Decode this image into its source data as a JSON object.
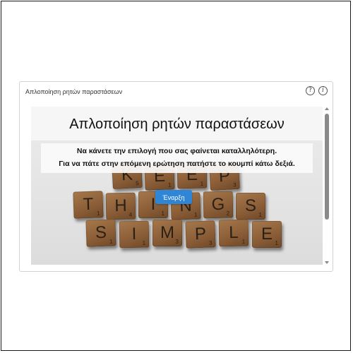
{
  "widget": {
    "header_title": "Απλοποίηση ρητών παραστάσεων",
    "help_icon": "question-circle-icon",
    "info_icon": "info-circle-icon",
    "help_symbol": "?",
    "info_symbol": "i"
  },
  "slide": {
    "title": "Απλοποίηση ρητών παραστάσεων",
    "instruction_line1": "Να κάνετε την επιλογή που σας φαίνεται καταλληλότερη.",
    "instruction_line2": "Για να πάτε στην επόμενη ερώτηση πατήστε το κουμπί κάτω δεξιά.",
    "start_button_label": "Έναρξη"
  },
  "image_tiles": {
    "row1": [
      {
        "letter": "K",
        "value": "5"
      },
      {
        "letter": "E",
        "value": "1"
      },
      {
        "letter": "E",
        "value": "1"
      },
      {
        "letter": "P",
        "value": "3"
      }
    ],
    "row2": [
      {
        "letter": "T",
        "value": "1"
      },
      {
        "letter": "H",
        "value": "4"
      },
      {
        "letter": "I",
        "value": "1"
      },
      {
        "letter": "N",
        "value": "1"
      },
      {
        "letter": "G",
        "value": "2"
      },
      {
        "letter": "S",
        "value": "1"
      }
    ],
    "row3": [
      {
        "letter": "S",
        "value": "1"
      },
      {
        "letter": "I",
        "value": "1"
      },
      {
        "letter": "M",
        "value": "3"
      },
      {
        "letter": "P",
        "value": "3"
      },
      {
        "letter": "L",
        "value": "1"
      },
      {
        "letter": "E",
        "value": "1"
      }
    ]
  },
  "colors": {
    "start_button": "#2f86d6",
    "tile_wood": "#8c5f38"
  }
}
